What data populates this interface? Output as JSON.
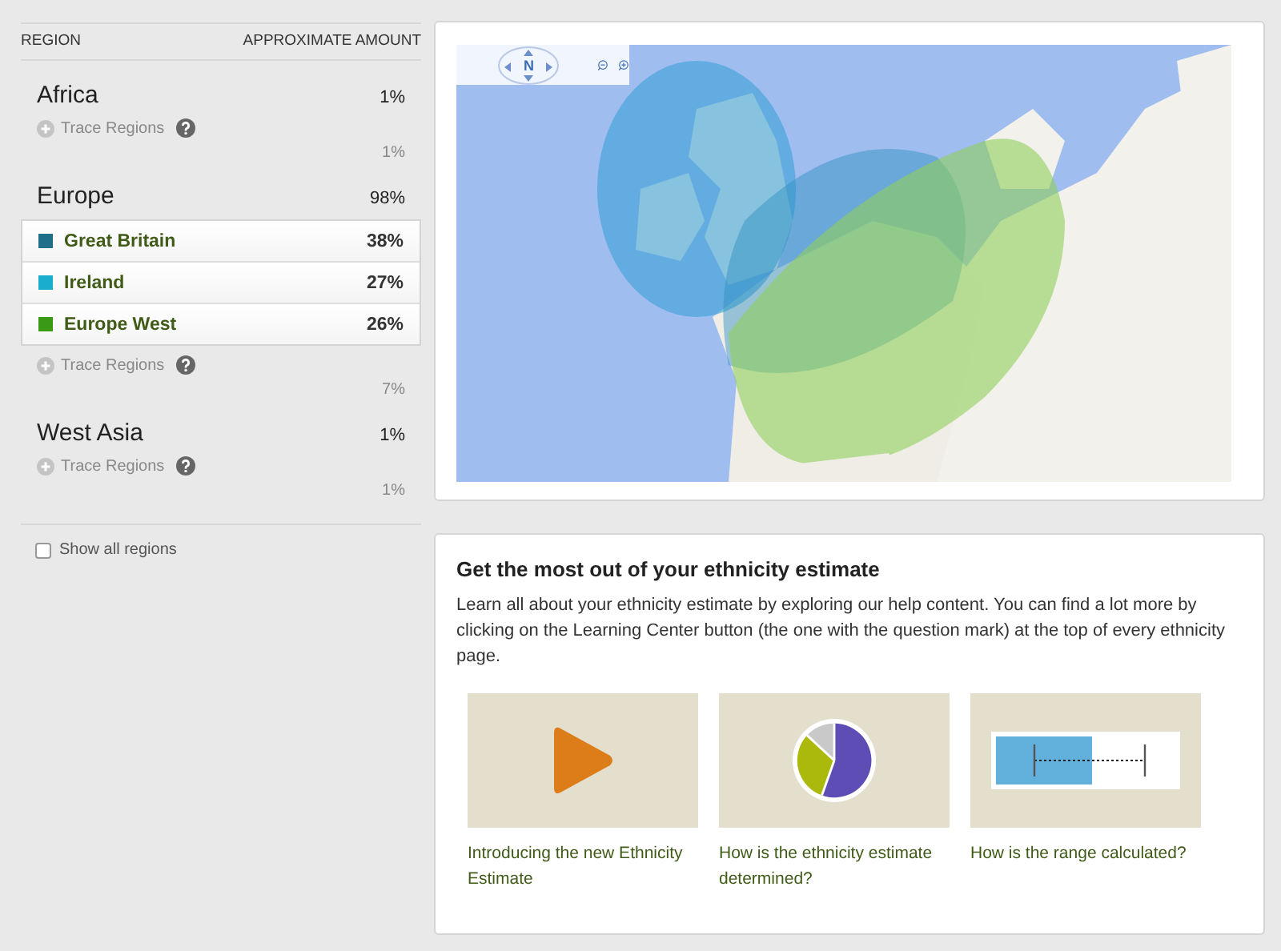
{
  "regions_panel": {
    "columns": [
      "REGION",
      "APPROXIMATE AMOUNT"
    ],
    "regions": [
      {
        "name": "Africa",
        "amount": "1%",
        "trace_label": "Trace Regions",
        "trace_amount": "1%"
      },
      {
        "name": "Europe",
        "amount": "98%",
        "trace_label": "Trace Regions",
        "trace_amount": "7%",
        "subregions": [
          {
            "name": "Great Britain",
            "amount": "38%",
            "color": "#1f6f8b"
          },
          {
            "name": "Ireland",
            "amount": "27%",
            "color": "#19aecb"
          },
          {
            "name": "Europe West",
            "amount": "26%",
            "color": "#3a9a16"
          }
        ]
      },
      {
        "name": "West Asia",
        "amount": "1%",
        "trace_label": "Trace Regions",
        "trace_amount": "1%"
      }
    ],
    "show_all": {
      "label": "Show all regions",
      "checked": false
    }
  },
  "map": {
    "kind": "picture",
    "compass_label": "N"
  },
  "help": {
    "title": "Get the most out of your ethnicity estimate",
    "text": "Learn all about your ethnicity estimate by exploring our help content. You can find a lot more by clicking on the Learning Center button (the one with the question mark) at the top of every ethnicity page.",
    "items": [
      {
        "kind": "video",
        "caption": "Introducing the new Ethnicity Estimate"
      },
      {
        "kind": "pie",
        "caption": "How is the ethnicity estimate determined?"
      },
      {
        "kind": "range",
        "caption": "How is the range calculated?"
      }
    ]
  }
}
